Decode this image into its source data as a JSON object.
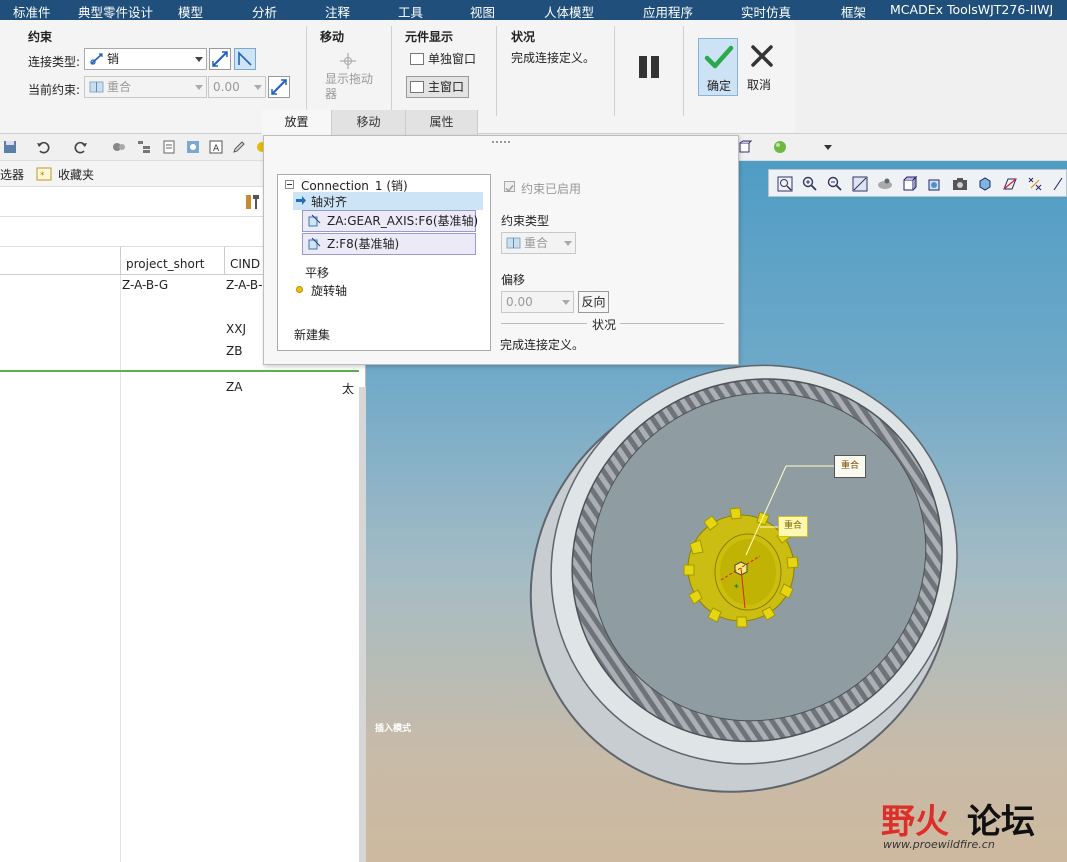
{
  "menu": [
    "标准件",
    "典型零件设计",
    "模型",
    "分析",
    "注释",
    "工具",
    "视图",
    "人体模型",
    "应用程序",
    "实时仿真",
    "框架",
    "MCADEx ToolsWJT276-IIWJ"
  ],
  "ribbon": {
    "constraint_group": "约束",
    "connection_type_label": "连接类型:",
    "connection_type_value": "销",
    "current_constraint_label": "当前约束:",
    "current_constraint_value": "重合",
    "offset_value": "0.00",
    "move_group": "移动",
    "show_drag_label": "显示拖动器",
    "component_display_group": "元件显示",
    "single_window": "单独窗口",
    "main_window": "主窗口",
    "status_group": "状况",
    "status_text": "完成连接定义。",
    "ok_label": "确定",
    "cancel_label": "取消"
  },
  "tabs": [
    "放置",
    "移动",
    "属性"
  ],
  "left": {
    "toolbar_items": [
      "选器",
      "收藏夹"
    ],
    "columns": [
      "project_short",
      "CIND"
    ],
    "rows": [
      {
        "project_short": "Z-A-B-G",
        "cind": "Z-A-B-"
      },
      {
        "project_short": "",
        "cind": "XXJ"
      },
      {
        "project_short": "",
        "cind": "ZB"
      },
      {
        "project_short": "",
        "cind": "ZA",
        "extra": "太"
      }
    ]
  },
  "dialog": {
    "tree_root": "Connection_1 (销)",
    "axis_align": "轴对齐",
    "ref1": "ZA:GEAR_AXIS:F6(基准轴)",
    "ref2": "Z:F8(基准轴)",
    "translate": "平移",
    "rotate_axis": "旋转轴",
    "new_set": "新建集",
    "constraint_enabled": "约束已启用",
    "constraint_type_label": "约束类型",
    "constraint_type_value": "重合",
    "offset_label": "偏移",
    "offset_value": "0.00",
    "flip_label": "反向",
    "status_label": "状况",
    "status_text": "完成连接定义。"
  },
  "viewport": {
    "tag_big": "重合",
    "tag_small": "重合",
    "mode_label": "插入模式"
  },
  "watermark": {
    "brand_a": "野火",
    "brand_b": "论坛",
    "url": "www.proewildfire.cn"
  },
  "colors": {
    "menubar": "#1f4f7a",
    "gear_yellow": "#e6d60f",
    "ok_green": "#2aa84a",
    "watermark_red": "#e0201d"
  }
}
